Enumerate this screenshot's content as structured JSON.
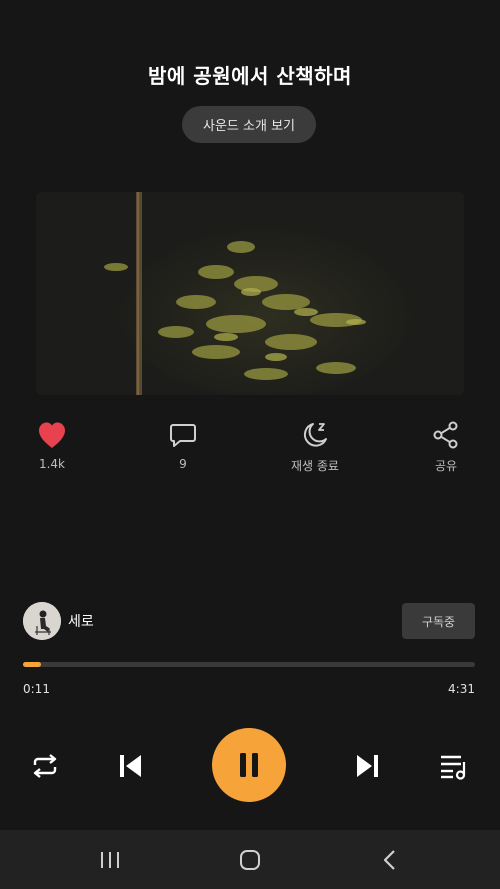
{
  "track": {
    "title": "밤에 공원에서 산책하며",
    "intro_button": "사운드 소개 보기"
  },
  "actions": [
    {
      "name": "like",
      "icon": "heart-icon",
      "label": "1.4k",
      "color": "#e8424f"
    },
    {
      "name": "comments",
      "icon": "comment-icon",
      "label": "9"
    },
    {
      "name": "sleep-timer",
      "icon": "moon-icon",
      "label": "재생 종료"
    },
    {
      "name": "share",
      "icon": "share-icon",
      "label": "공유"
    }
  ],
  "artist": {
    "name": "세로",
    "subscribe_label": "구독중"
  },
  "player": {
    "current_time": "0:11",
    "total_time": "4:31",
    "progress": 0.04,
    "accent_color": "#f6a43a"
  },
  "controls": [
    "repeat-icon",
    "previous-icon",
    "pause-icon",
    "next-icon",
    "playlist-icon"
  ],
  "system_nav": [
    "recent-apps-icon",
    "home-icon",
    "back-icon"
  ]
}
